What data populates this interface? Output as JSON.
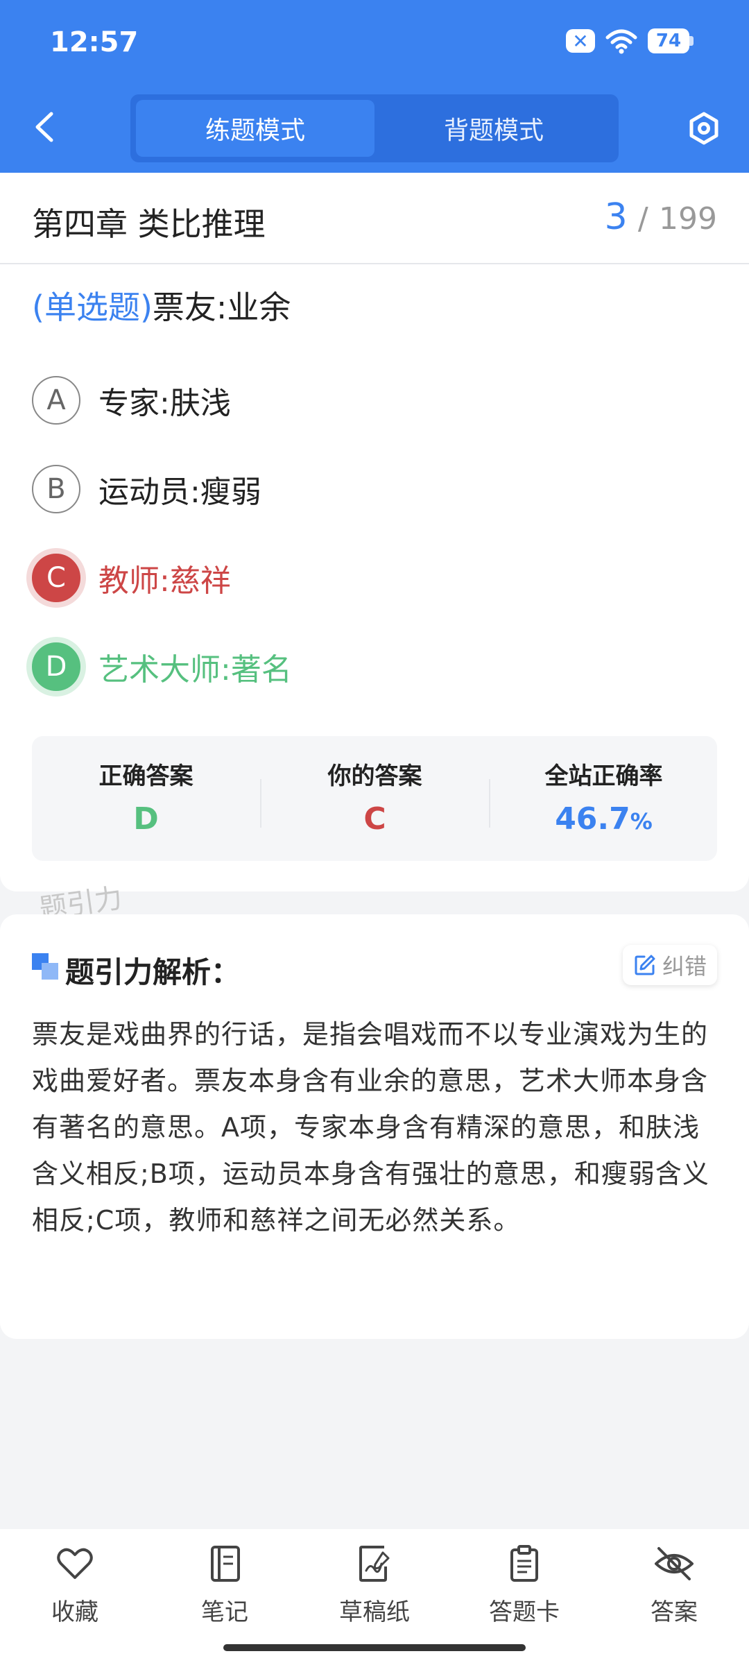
{
  "status_bar": {
    "time": "12:57",
    "battery": "74"
  },
  "header": {
    "tabs": [
      {
        "label": "练题模式",
        "active": true
      },
      {
        "label": "背题模式",
        "active": false
      }
    ]
  },
  "chapter": {
    "title": "第四章 类比推理",
    "current": "3",
    "separator": "/",
    "total": "199"
  },
  "question": {
    "type": "(单选题)",
    "stem": "票友:业余"
  },
  "options": [
    {
      "letter": "A",
      "text": "专家:肤浅",
      "state": "normal"
    },
    {
      "letter": "B",
      "text": "运动员:瘦弱",
      "state": "normal"
    },
    {
      "letter": "C",
      "text": "教师:慈祥",
      "state": "wrong"
    },
    {
      "letter": "D",
      "text": "艺术大师:著名",
      "state": "correct"
    }
  ],
  "result": {
    "correct_label": "正确答案",
    "correct_value": "D",
    "yours_label": "你的答案",
    "yours_value": "C",
    "rate_label": "全站正确率",
    "rate_value": "46.7",
    "rate_unit": "%"
  },
  "watermark": "题引力",
  "analysis": {
    "title": "题引力解析：",
    "report_label": "纠错",
    "text": "票友是戏曲界的行话，是指会唱戏而不以专业演戏为生的戏曲爱好者。票友本身含有业余的意思，艺术大师本身含有著名的意思。A项，专家本身含有精深的意思，和肤浅含义相反;B项，运动员本身含有强壮的意思，和瘦弱含义相反;C项，教师和慈祥之间无必然关系。"
  },
  "bottom_nav": [
    {
      "label": "收藏",
      "icon": "heart-icon"
    },
    {
      "label": "笔记",
      "icon": "notebook-icon"
    },
    {
      "label": "草稿纸",
      "icon": "draft-icon"
    },
    {
      "label": "答题卡",
      "icon": "clipboard-icon"
    },
    {
      "label": "答案",
      "icon": "eye-off-icon"
    }
  ],
  "colors": {
    "primary": "#3b82f0",
    "wrong": "#cd4646",
    "correct": "#56c07f"
  }
}
